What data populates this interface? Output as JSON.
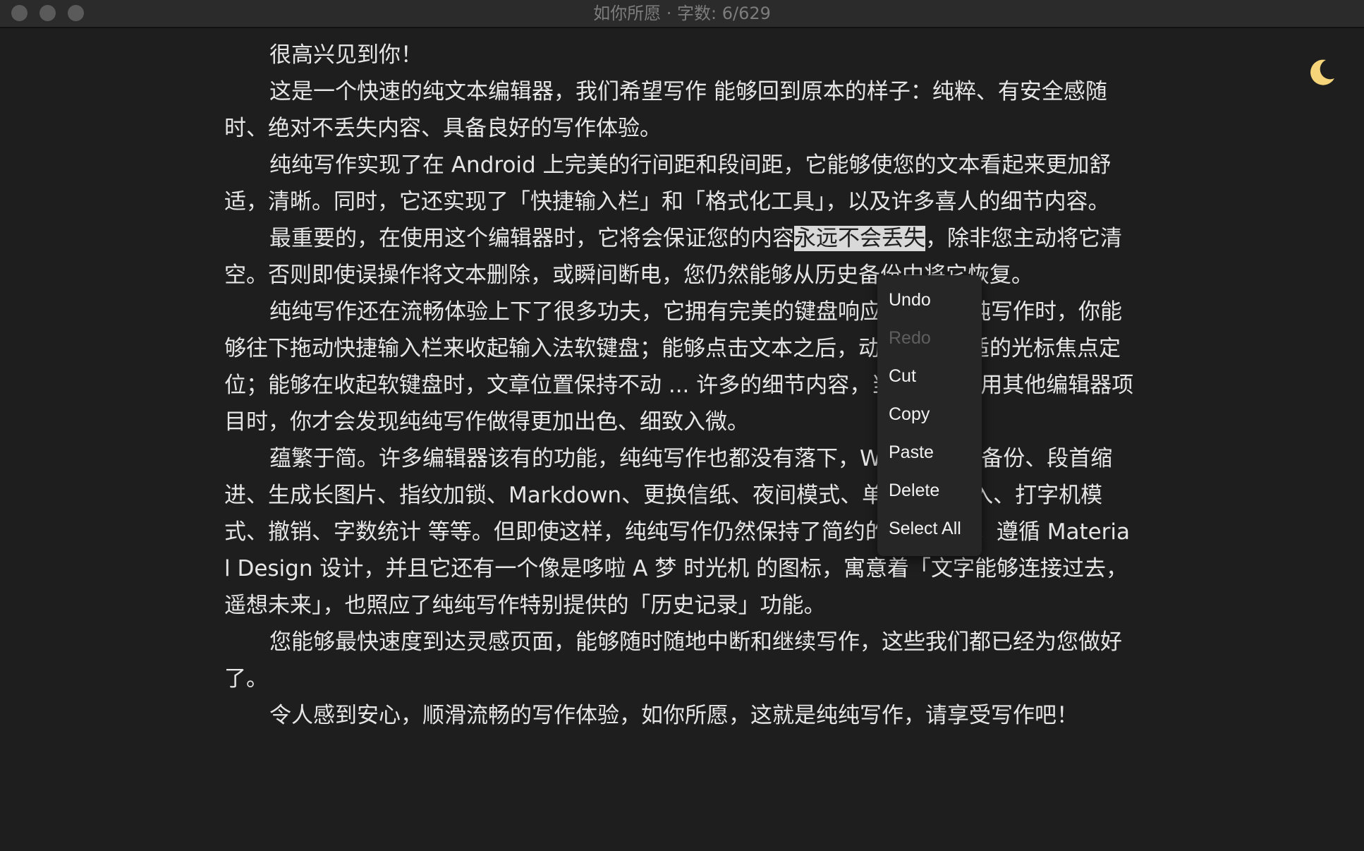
{
  "window": {
    "title": "如你所愿 · 字数: 6/629"
  },
  "icons": {
    "theme_toggle": "moon-icon",
    "moon_color": "#f6d57a"
  },
  "editor": {
    "paragraphs": [
      {
        "text": "很高兴见到你！"
      },
      {
        "text": "这是一个快速的纯文本编辑器，我们希望写作 能够回到原本的样子：纯粹、有安全感随时、绝对不丢失内容、具备良好的写作体验。"
      },
      {
        "text": "纯纯写作实现了在 Android 上完美的行间距和段间距，它能够使您的文本看起来更加舒适，清晰。同时，它还实现了「快捷输入栏」和「格式化工具」，以及许多喜人的细节内容。"
      },
      {
        "before": "最重要的，在使用这个编辑器时，它将会保证您的内容",
        "selected": "永远不会丢失",
        "after": "，除非您主动将它清空。否则即使误操作将文本删除，或瞬间断电，您仍然能够从历史备份中将它恢复。"
      },
      {
        "text": "纯纯写作还在流畅体验上下了很多功夫，它拥有完美的键盘响应，使用纯纯写作时，你能够往下拖动快捷输入栏来收起输入法软键盘；能够点击文本之后，动态获得合适的光标焦点定位；能够在收起软键盘时，文章位置保持不动 ... 许多的细节内容，当你对比使用其他编辑器项目时，你才会发现纯纯写作做得更加出色、细致入微。"
      },
      {
        "text": "蕴繁于简。许多编辑器该有的功能，纯纯写作也都没有落下，WebDAV 云备份、段首缩进、生成长图片、指纹加锁、Markdown、更换信纸、夜间模式、单词联想输入、打字机模式、撤销、字数统计 等等。但即使这样，纯纯写作仍然保持了简约的设计风格，遵循 Material Design 设计，并且它还有一个像是哆啦 A 梦 时光机 的图标，寓意着「文字能够连接过去，遥想未来」，也照应了纯纯写作特别提供的「历史记录」功能。"
      },
      {
        "text": "您能够最快速度到达灵感页面，能够随时随地中断和继续写作，这些我们都已经为您做好了。"
      },
      {
        "text": "令人感到安心，顺滑流畅的写作体验，如你所愿，这就是纯纯写作，请享受写作吧！"
      }
    ]
  },
  "context_menu": {
    "items": [
      {
        "label": "Undo",
        "enabled": true
      },
      {
        "label": "Redo",
        "enabled": false
      },
      {
        "label": "Cut",
        "enabled": true
      },
      {
        "label": "Copy",
        "enabled": true
      },
      {
        "label": "Paste",
        "enabled": true
      },
      {
        "label": "Delete",
        "enabled": true
      },
      {
        "label": "Select All",
        "enabled": true
      }
    ]
  }
}
